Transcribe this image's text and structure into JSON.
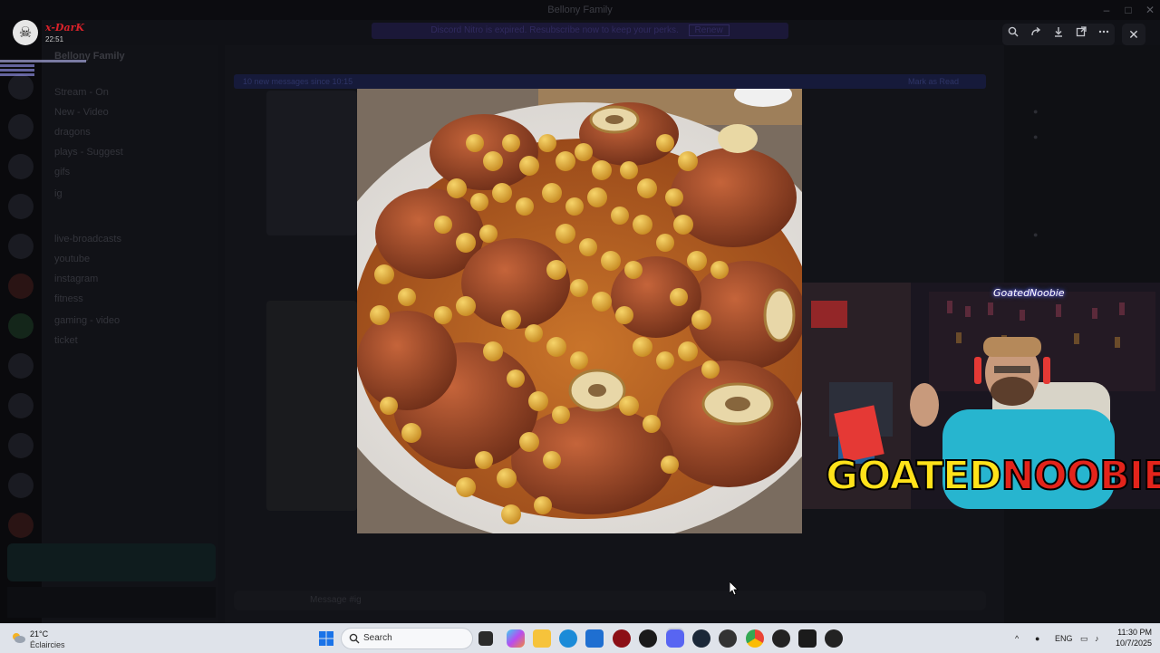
{
  "window": {
    "title": "Bellony Family",
    "minimize": "–",
    "maximize": "□",
    "close": "✕"
  },
  "streamer": {
    "name": "x-DarK",
    "time": "22:51"
  },
  "discord": {
    "server_name": "Bellony Family",
    "notice": "Discord Nitro is expired. Resubscribe now to keep your perks.",
    "notice_button": "Renew",
    "channels": [
      "Stream - On",
      "New - Video",
      "dragons",
      "plays - Suggest",
      "gifs",
      "ig",
      "live-broadcasts",
      "youtube",
      "instagram",
      "fitness",
      "gaming - video",
      "ticket"
    ],
    "banner": "10 new messages since 10:15",
    "banner_action": "Mark as Read",
    "composer_placeholder": "Message #ig"
  },
  "image_viewer": {
    "tools": [
      "zoom-icon",
      "forward-icon",
      "download-icon",
      "open-external-icon",
      "more-icon"
    ],
    "close_label": "✕"
  },
  "webcam": {
    "handle": "GoatedNoobie",
    "logo_part1": "GOATED",
    "logo_part2": "NOOBIE"
  },
  "taskbar": {
    "weather_temp": "21°C",
    "weather_cond": "Éclaircies",
    "search_placeholder": "Search",
    "language": "ENG",
    "time": "11:30 PM",
    "date": "10/7/2025"
  },
  "colors": {
    "accent": "#5865f2",
    "streamer_name": "#d8222a",
    "logo_yellow": "#ffe21a",
    "logo_red": "#e3241b"
  }
}
